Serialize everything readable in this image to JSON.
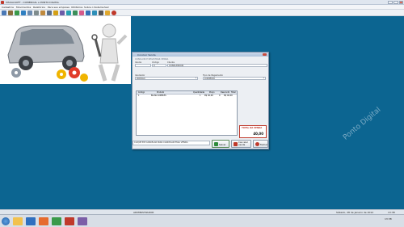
{
  "window": {
    "title": "VISUALSOFT - COMERCIAL e PONTO DIGITAL"
  },
  "menu": [
    "Cadastros",
    "Movimentos",
    "Relatórios",
    "Para seu empresa",
    "Utilitários",
    "Sobre o Sistema",
    "Sair"
  ],
  "toolbar_icons": [
    "person-icon",
    "scales-icon",
    "money-icon",
    "check-icon",
    "document-icon",
    "calculator-icon",
    "box-icon",
    "truck-icon",
    "house-icon",
    "people-icon",
    "phone-icon",
    "chart-icon",
    "heart-icon",
    "info-icon",
    "globe-icon",
    "camera-icon",
    "star-icon",
    "close-circle-icon"
  ],
  "dialog": {
    "title": "Concluir Venda",
    "section_label": "CONCLUIR E REGISTRAR VENDA",
    "venda_label": "Venda",
    "venda_value": "",
    "codigo_label": "Código",
    "codigo_value": "0",
    "cliente_label": "Cliente",
    "cliente_value": "CONSUMIDOR",
    "vendedor_label": "Vendedor",
    "vendedor_value": "PADRÃO",
    "pagamento_label": "Tipo de Pagamento",
    "pagamento_value": "DINHEIRO",
    "grid": {
      "columns": [
        "Código",
        "Produto",
        "Quantidade",
        "Preço",
        "Desconto",
        "Total"
      ],
      "rows": [
        [
          "1",
          "BLUSA SIMPLES",
          "1",
          "R$ 40,00",
          "0",
          "R$ 40,00"
        ]
      ]
    },
    "total_label": "TOTAL DA VENDA",
    "total_value": "40,00",
    "status_text": "CLIQUE EM CANCELAR PARA CANCELAR ESSA VENDA",
    "buttons": {
      "save": "Salvar",
      "cancel": "Cancelar venda",
      "close": "Fechar"
    }
  },
  "bottom_status": "ADMINISTRADOR",
  "date_time": "Sábado, 28 de Janeiro de 2012",
  "clock": "13:38",
  "watermark": "Ponto Digital",
  "colors": {
    "desktop": "#0c6591",
    "accent_red": "#c0392b",
    "save_green": "#2e8b3a"
  }
}
